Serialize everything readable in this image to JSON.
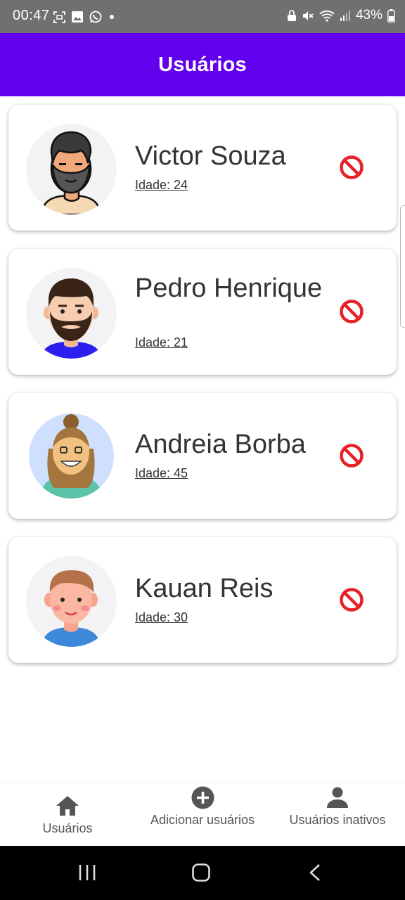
{
  "status_bar": {
    "time": "00:47",
    "battery": "43%",
    "left_icons": [
      "screenshot-icon",
      "gallery-icon",
      "whatsapp-icon",
      "dot-icon"
    ],
    "right_icons": [
      "lock-icon",
      "mute-icon",
      "wifi-icon",
      "signal-icon",
      "battery-icon"
    ]
  },
  "app_bar": {
    "title": "Usuários"
  },
  "users": [
    {
      "name": "Victor Souza",
      "age": "Idade: 24"
    },
    {
      "name": "Pedro Henrique",
      "age": "Idade: 21"
    },
    {
      "name": "Andreia Borba",
      "age": "Idade: 45"
    },
    {
      "name": "Kauan Reis",
      "age": "Idade: 30"
    }
  ],
  "colors": {
    "primary": "#6200ee",
    "deactivate": "#e8202a",
    "text": "#333333"
  },
  "bottom_nav": {
    "items": [
      {
        "label": "Usuários",
        "icon": "home-icon"
      },
      {
        "label": "Adicionar usuários",
        "icon": "add-circle-icon"
      },
      {
        "label": "Usuários inativos",
        "icon": "person-icon"
      }
    ]
  },
  "system_nav": {
    "buttons": [
      "recents-icon",
      "home-button-icon",
      "back-icon"
    ]
  }
}
